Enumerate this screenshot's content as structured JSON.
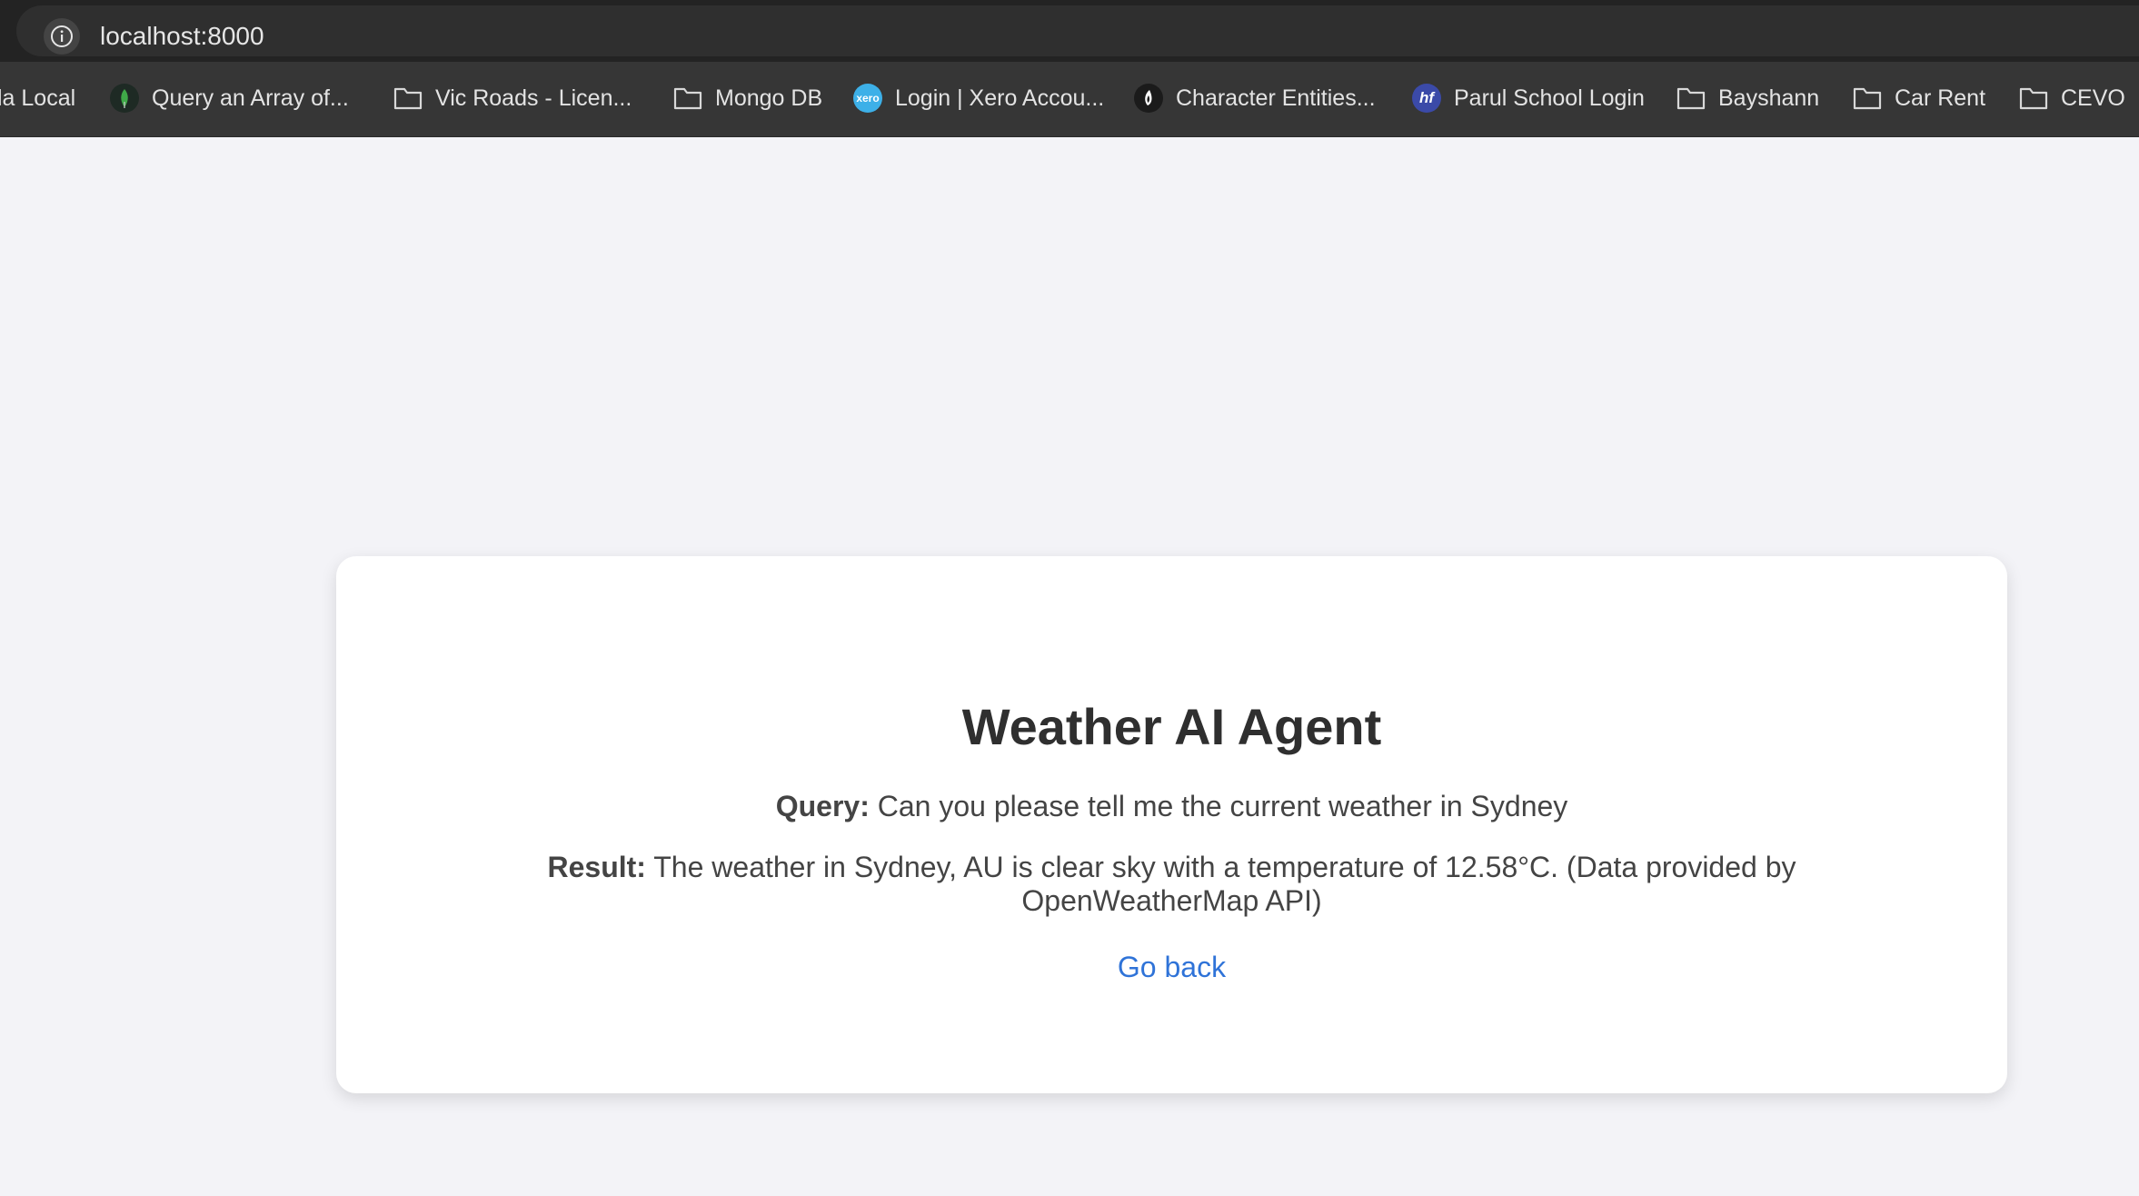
{
  "browser": {
    "url": "localhost:8000",
    "bookmarks": [
      {
        "label": "la Local",
        "icon": "none"
      },
      {
        "label": "Query an Array of...",
        "icon": "mongodb-leaf-icon"
      },
      {
        "label": "Vic Roads - Licen...",
        "icon": "folder-icon"
      },
      {
        "label": "Mongo DB",
        "icon": "folder-icon"
      },
      {
        "label": "Login | Xero Accou...",
        "icon": "xero-icon"
      },
      {
        "label": "Character Entities...",
        "icon": "character-entities-icon"
      },
      {
        "label": "Parul School Login",
        "icon": "parul-school-icon"
      },
      {
        "label": "Bayshann",
        "icon": "folder-icon"
      },
      {
        "label": "Car Rent",
        "icon": "folder-icon"
      },
      {
        "label": "CEVO",
        "icon": "folder-icon"
      }
    ],
    "xero_favicon_text": "xero",
    "parul_favicon_text": "hf",
    "colors": {
      "xero": "#3db0e8",
      "mongodb_leaf": "#3fa948",
      "parul": "#3b4aa8"
    }
  },
  "page": {
    "title": "Weather AI Agent",
    "query_label": "Query:",
    "query_text": " Can you please tell me the current weather in Sydney",
    "result_label": "Result:",
    "result_text": " The weather in Sydney, AU is clear sky with a temperature of 12.58°C. (Data provided by OpenWeatherMap API)",
    "link_label": "Go back",
    "link_color": "#2f73d8"
  }
}
